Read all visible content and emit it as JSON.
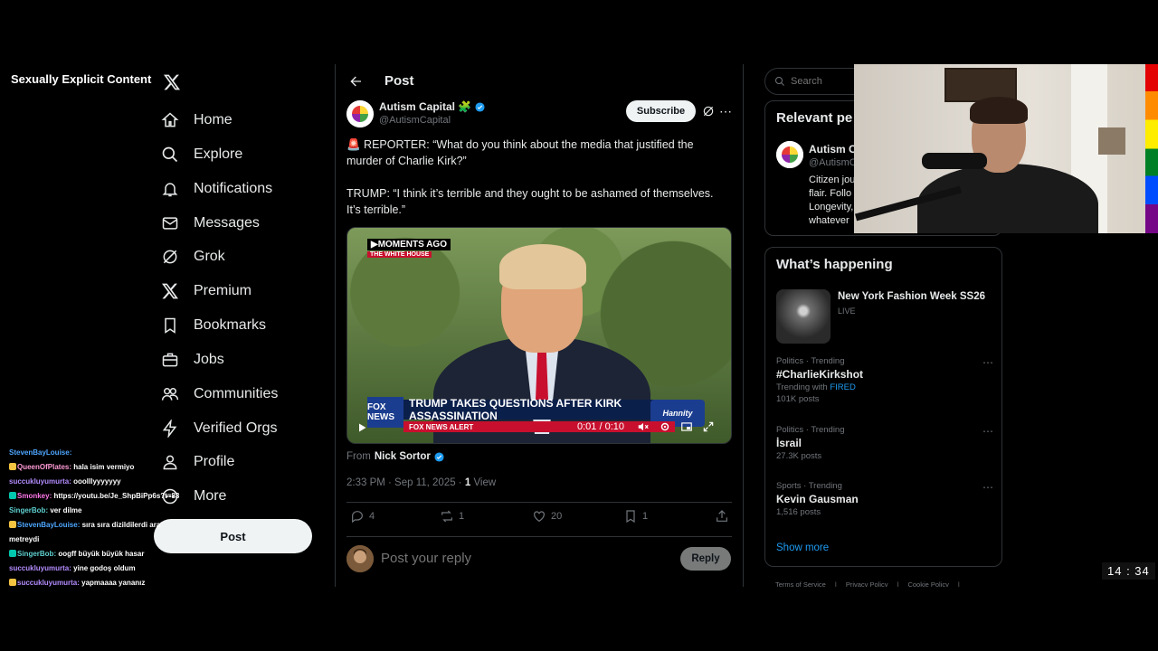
{
  "overlay": {
    "nsfw_label": "Sexually Explicit Content",
    "clock": "14 : 34"
  },
  "nav": {
    "items": [
      {
        "label": "Home",
        "icon": "home-icon"
      },
      {
        "label": "Explore",
        "icon": "search-icon"
      },
      {
        "label": "Notifications",
        "icon": "bell-icon"
      },
      {
        "label": "Messages",
        "icon": "mail-icon"
      },
      {
        "label": "Grok",
        "icon": "grok-icon"
      },
      {
        "label": "Premium",
        "icon": "x-icon"
      },
      {
        "label": "Bookmarks",
        "icon": "bookmark-icon"
      },
      {
        "label": "Jobs",
        "icon": "briefcase-icon"
      },
      {
        "label": "Communities",
        "icon": "people-icon"
      },
      {
        "label": "Verified Orgs",
        "icon": "bolt-icon"
      },
      {
        "label": "Profile",
        "icon": "person-icon"
      },
      {
        "label": "More",
        "icon": "more-circle-icon"
      }
    ],
    "post_label": "Post"
  },
  "chat": [
    {
      "user": "StevenBayLouise:",
      "msg": "",
      "color": "#4da6ff"
    },
    {
      "user": "QueenOfPlates:",
      "msg": "hala isim vermiyo",
      "color": "#ff9ad5"
    },
    {
      "user": "succukluyumurta:",
      "msg": "ooolllyyyyyyy",
      "color": "#b48cff"
    },
    {
      "user": "Smonkey:",
      "msg": "https://youtu.be/Je_ShpBiPp6s?t=83",
      "color": "#ff77e9"
    },
    {
      "user": "SingerBob:",
      "msg": "ver dilme",
      "color": "#5fd0d0"
    },
    {
      "user": "StevenBayLouise:",
      "msg": "sıra sıra dizildilerdi ara",
      "color": "#4da6ff"
    },
    {
      "user": "",
      "msg": "metreydi",
      "color": "#ffffff"
    },
    {
      "user": "SingerBob:",
      "msg": "oogff büyük büyük hasar",
      "color": "#5fd0d0"
    },
    {
      "user": "succukluyumurta:",
      "msg": "yine godoş oldum",
      "color": "#b48cff"
    },
    {
      "user": "succukluyumurta:",
      "msg": "yapmaaaa yananız",
      "color": "#b48cff"
    }
  ],
  "header": {
    "title": "Post"
  },
  "tweet": {
    "author_name": "Autism Capital 🧩",
    "author_handle": "@AutismCapital",
    "subscribe_label": "Subscribe",
    "text_1": "🚨 REPORTER: “What do you think about the media that justified the murder of Charlie Kirk?”",
    "text_2": "TRUMP: “I think it’s terrible and they ought to be ashamed of themselves. It’s terrible.”",
    "video": {
      "badge_top": "▶MOMENTS AGO",
      "badge_sub": "THE WHITE HOUSE",
      "network": "FOX NEWS",
      "headline": "TRUMP TAKES QUESTIONS AFTER KIRK ASSASSINATION",
      "ticker": "FOX NEWS ALERT",
      "show": "Hannity",
      "time": "0:01 / 0:10"
    },
    "from_label": "From",
    "from_name": "Nick Sortor",
    "timestamp": "2:33 PM · Sep 11, 2025 · ",
    "views_count": "1",
    "views_label": " View",
    "replies": "4",
    "reposts": "1",
    "likes": "20",
    "bookmarks": "1"
  },
  "reply": {
    "placeholder": "Post your reply",
    "button": "Reply"
  },
  "right": {
    "search_placeholder": "Search",
    "relevant_title": "Relevant pe",
    "relevant_name": "Autism Ca",
    "relevant_handle": "@AutismC",
    "relevant_bio": "Citizen jou flair. Follo Longevity, whatever",
    "happening_title": "What’s happening",
    "featured": {
      "title": "New York Fashion Week SS26",
      "status": "LIVE"
    },
    "trends": [
      {
        "category": "Politics · Trending",
        "name": "#CharlieKirkshot",
        "extra_prefix": "Trending with ",
        "extra_link": "FIRED",
        "posts": "101K posts"
      },
      {
        "category": "Politics · Trending",
        "name": "İsrail",
        "extra_prefix": "",
        "extra_link": "",
        "posts": "27.3K posts"
      },
      {
        "category": "Sports · Trending",
        "name": "Kevin Gausman",
        "extra_prefix": "",
        "extra_link": "",
        "posts": "1,516 posts"
      }
    ],
    "show_more": "Show more",
    "footer": [
      "Terms of Service",
      "|",
      "Privacy Policy",
      "|",
      "Cookie Policy",
      "|"
    ]
  },
  "colors": {
    "accent": "#1d9bf0",
    "bg": "#000000",
    "border": "#2f3336",
    "muted": "#71767b"
  }
}
